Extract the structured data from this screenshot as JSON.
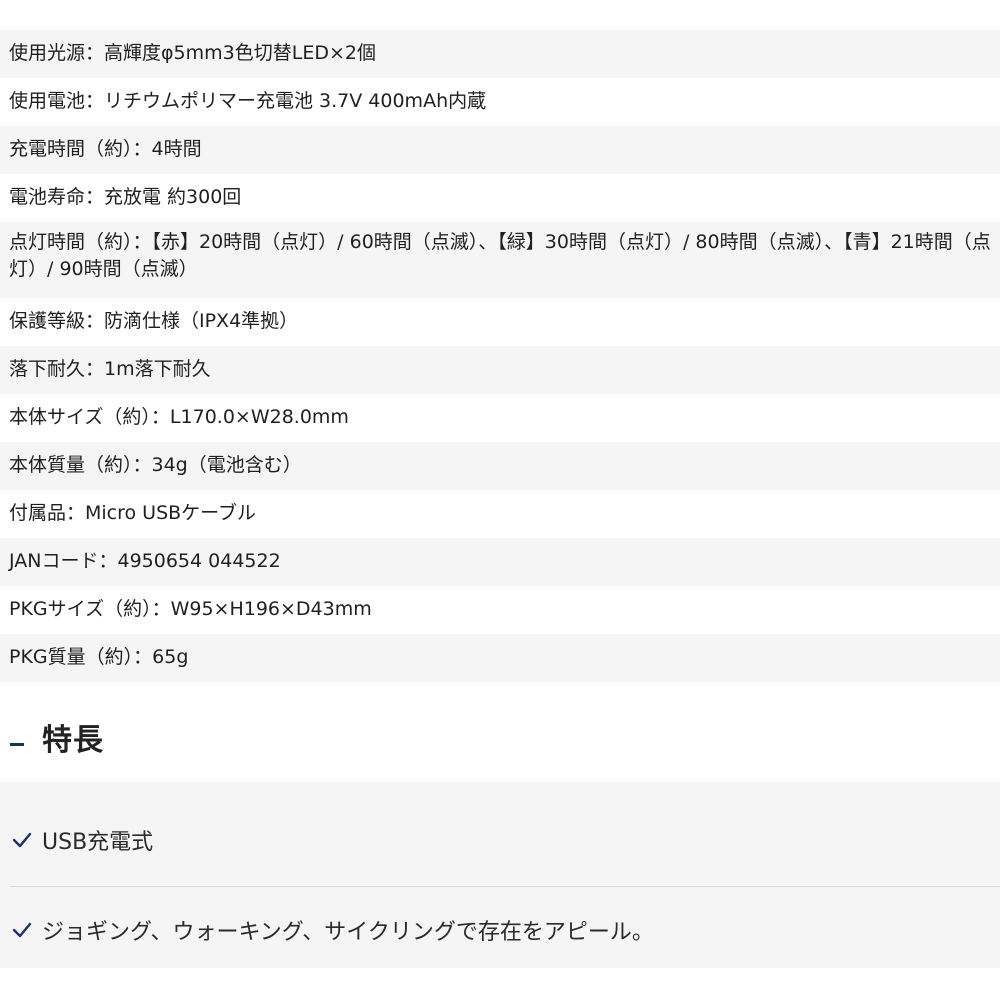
{
  "specs": [
    "使用光源：高輝度φ5mm3色切替LED×2個",
    "使用電池：リチウムポリマー充電池 3.7V 400mAh内蔵",
    "充電時間（約）：4時間",
    "電池寿命：充放電 約300回",
    "点灯時間（約）：【赤】20時間（点灯）/ 60時間（点滅）、【緑】30時間（点灯）/ 80時間（点滅）、【青】21時間（点灯）/ 90時間（点滅）",
    "保護等級：防滴仕様（IPX4準拠）",
    "落下耐久：1m落下耐久",
    "本体サイズ（約）：L170.0×W28.0mm",
    "本体質量（約）：34g（電池含む）",
    "付属品：Micro USBケーブル",
    "JANコード：4950654 044522",
    "PKGサイズ（約）：W95×H196×D43mm",
    "PKG質量（約）：65g"
  ],
  "features_section": {
    "heading": "特長",
    "items": [
      "USB充電式",
      "ジョギング、ウォーキング、サイクリングで存在をアピール。"
    ]
  },
  "colors": {
    "accent": "#1b2f6b",
    "row_alt": "#f5f5f5",
    "text": "#1f1f1f"
  },
  "icons": {
    "feature_marker": "check-icon",
    "heading_marker": "dash-mark"
  }
}
